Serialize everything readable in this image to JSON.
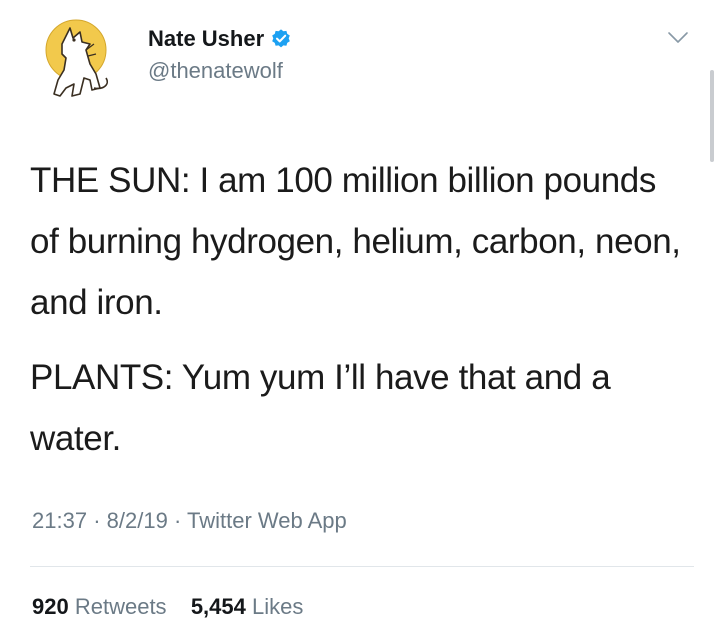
{
  "author": {
    "display_name": "Nate Usher",
    "handle": "@thenatewolf",
    "verified": true,
    "avatar_icon": "howling-wolf-moon-avatar"
  },
  "tweet": {
    "paragraphs": [
      "THE SUN: I am 100 million billion pounds of burning hydrogen, helium, carbon, neon, and iron.",
      "PLANTS: Yum yum I’ll have that and a water."
    ]
  },
  "meta": {
    "time": "21:37",
    "separator": "·",
    "date": "8/2/19",
    "source": "Twitter Web App"
  },
  "stats": {
    "retweets_count": "920",
    "retweets_label": "Retweets",
    "likes_count": "5,454",
    "likes_label": "Likes"
  },
  "colors": {
    "verified_blue": "#1da1f2",
    "muted_text": "#6b7a86",
    "avatar_moon": "#f2c94c"
  }
}
